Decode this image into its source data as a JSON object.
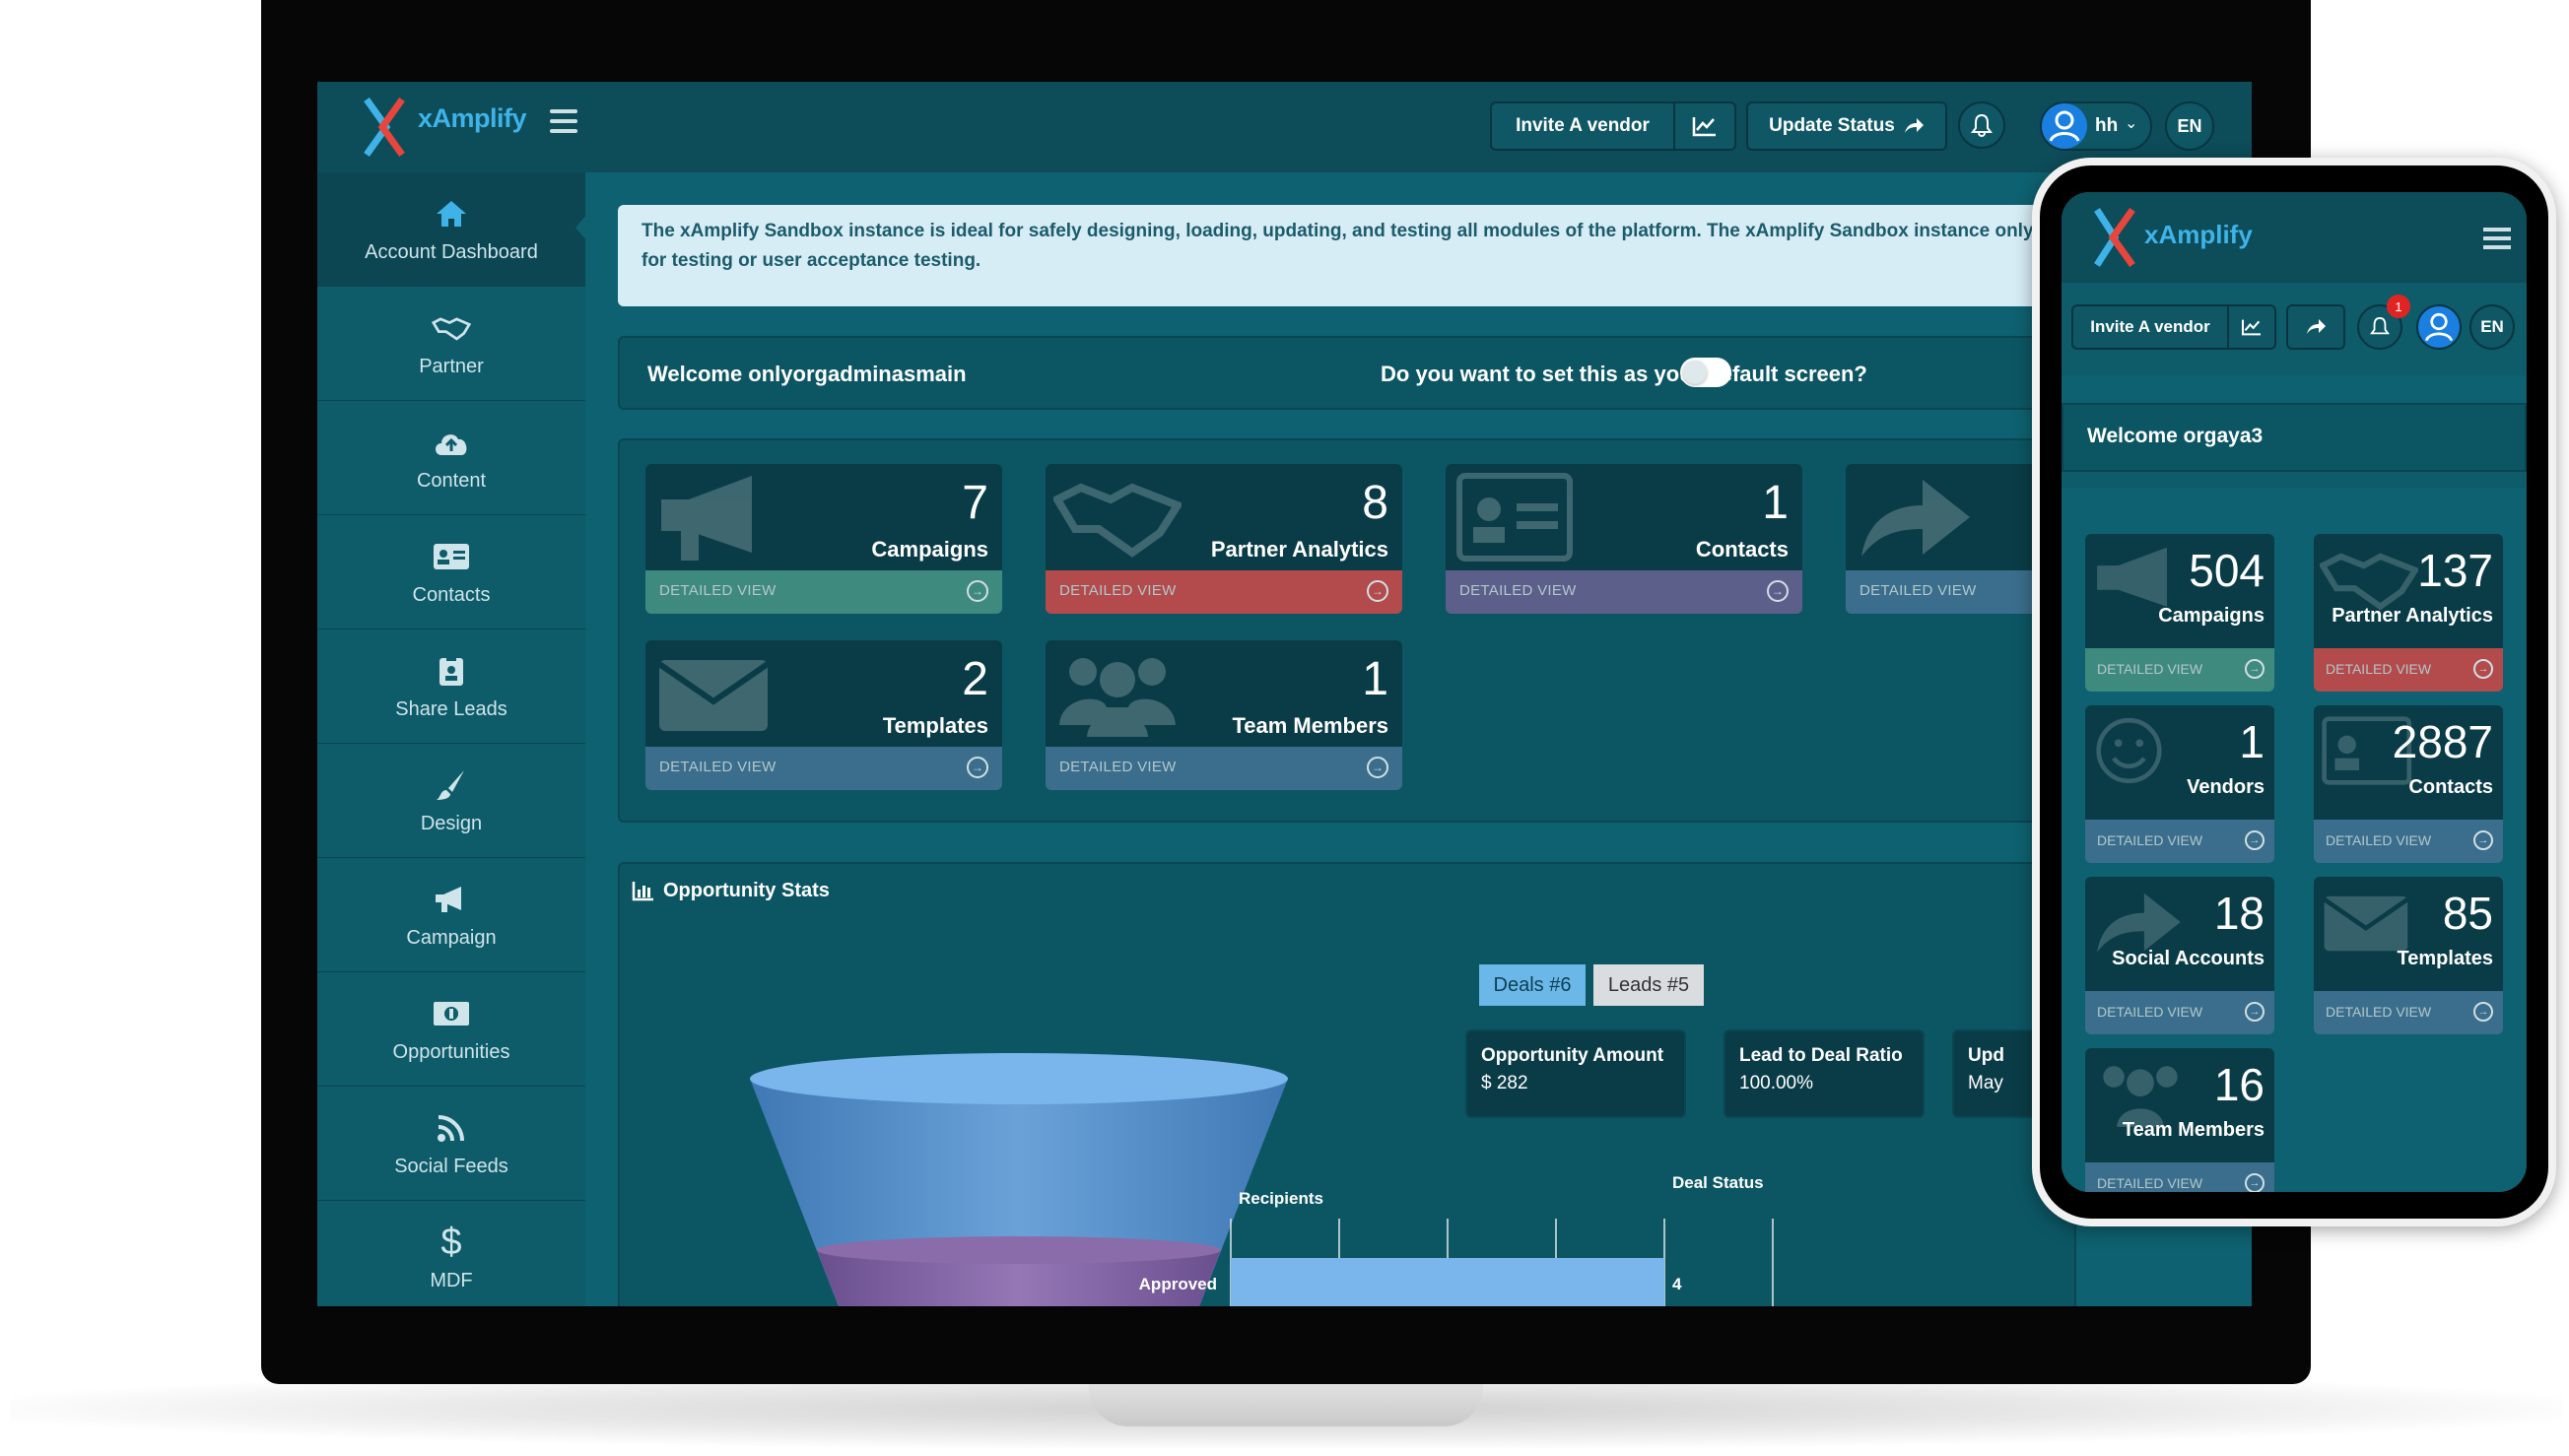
{
  "colors": {
    "green": "#3f8a7e",
    "red": "#b34a4b",
    "purple": "#5c5f8a",
    "blue": "#3a6e8c",
    "teal": "#0e6170"
  },
  "header": {
    "brand": "xAmplify",
    "invite_label": "Invite A vendor",
    "update_label": "Update Status",
    "user_initials": "hh",
    "lang": "EN"
  },
  "sidebar": {
    "items": [
      {
        "label": "Account Dashboard",
        "icon": "home-icon"
      },
      {
        "label": "Partner",
        "icon": "handshake-icon"
      },
      {
        "label": "Content",
        "icon": "cloud-upload-icon"
      },
      {
        "label": "Contacts",
        "icon": "id-card-icon"
      },
      {
        "label": "Share Leads",
        "icon": "clipboard-icon"
      },
      {
        "label": "Design",
        "icon": "brush-icon"
      },
      {
        "label": "Campaign",
        "icon": "megaphone-icon"
      },
      {
        "label": "Opportunities",
        "icon": "money-icon"
      },
      {
        "label": "Social Feeds",
        "icon": "rss-icon"
      },
      {
        "label": "MDF",
        "icon": "dollar-icon"
      }
    ]
  },
  "alert": {
    "text": "The xAmplify Sandbox instance is ideal for safely designing, loading, updating, and testing all modules of the platform. The xAmplify Sandbox instance only for testing or user acceptance testing."
  },
  "welcome": {
    "text": "Welcome onlyorgadminasmain",
    "default_question": "Do you want to set this as your default screen?"
  },
  "cards": [
    {
      "num": "7",
      "label": "Campaigns",
      "footer": "DETAILED VIEW"
    },
    {
      "num": "8",
      "label": "Partner Analytics",
      "footer": "DETAILED VIEW"
    },
    {
      "num": "1",
      "label": "Contacts",
      "footer": "DETAILED VIEW"
    },
    {
      "num": "",
      "label": "",
      "footer": "DETAILED VIEW"
    },
    {
      "num": "2",
      "label": "Templates",
      "footer": "DETAILED VIEW"
    },
    {
      "num": "1",
      "label": "Team Members",
      "footer": "DETAILED VIEW"
    }
  ],
  "opportunity": {
    "title": "Opportunity Stats",
    "tabs": [
      "Deals #6",
      "Leads #5"
    ],
    "stats": [
      {
        "label": "Opportunity Amount",
        "value": "$ 282"
      },
      {
        "label": "Lead to Deal Ratio",
        "value": "100.00%"
      },
      {
        "label": "Upd",
        "value": "May"
      }
    ],
    "funnel_label": "Recipients",
    "deal_status_title": "Deal Status",
    "bar_label": "Approved",
    "bar_value": "4"
  },
  "chart_data": {
    "type": "bar",
    "title": "Deal Status",
    "categories": [
      "Approved"
    ],
    "values": [
      4
    ]
  },
  "phone": {
    "brand": "xAmplify",
    "invite_label": "Invite A vendor",
    "notif_count": "1",
    "lang": "EN",
    "welcome": "Welcome orgaya3",
    "cards": [
      {
        "num": "504",
        "label": "Campaigns",
        "footer": "DETAILED VIEW"
      },
      {
        "num": "137",
        "label": "Partner Analytics",
        "footer": "DETAILED VIEW"
      },
      {
        "num": "1",
        "label": "Vendors",
        "footer": "DETAILED VIEW"
      },
      {
        "num": "2887",
        "label": "Contacts",
        "footer": "DETAILED VIEW"
      },
      {
        "num": "18",
        "label": "Social Accounts",
        "footer": "DETAILED VIEW"
      },
      {
        "num": "85",
        "label": "Templates",
        "footer": "DETAILED VIEW"
      },
      {
        "num": "16",
        "label": "Team Members",
        "footer": "DETAILED VIEW"
      }
    ]
  }
}
